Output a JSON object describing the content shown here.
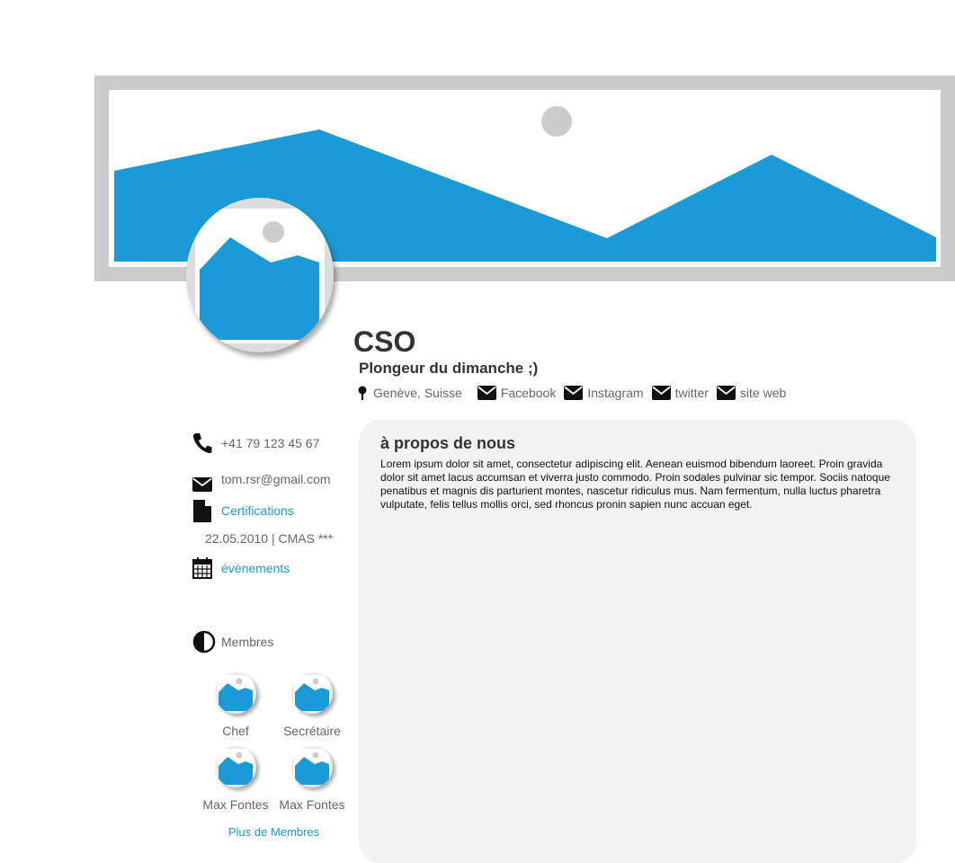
{
  "profile": {
    "name": "CSO",
    "tagline": "Plongeur du dimanche ;)"
  },
  "info_bar": {
    "location": "Genève, Suisse",
    "links": [
      "Facebook",
      "Instagram",
      "twitter",
      "site web"
    ]
  },
  "sidebar": {
    "phone": "+41 79 123 45 67",
    "email": "tom.rsr@gmail.com",
    "certifications_label": "Certifications",
    "certification_detail": "22.05.2010 | CMAS ***",
    "events_label": "évènements",
    "members_label": "Membres",
    "members": [
      {
        "name": "Chef"
      },
      {
        "name": "Secrétaire"
      },
      {
        "name": "Max Fontes"
      },
      {
        "name": "Max Fontes"
      }
    ],
    "more_members_label": "Plus de Membres"
  },
  "about": {
    "heading": "à propos de nous",
    "body": "Lorem ipsum dolor sit amet, consectetur adipiscing elit. Aenean euismod bibendum laoreet. Proin gravida dolor sit amet lacus accumsan et viverra justo commodo. Proin sodales pulvinar sic tempor. Sociis natoque penatibus et magnis dis parturient montes, nascetur ridiculus mus. Nam fermentum, nulla luctus pharetra vulputate, felis tellus mollis orci, sed rhoncus pronin sapien nunc accuan eget."
  },
  "colors": {
    "accent_blue": "#1a9bd7",
    "placeholder_gray": "#cccccc",
    "panel_bg": "#f2f2f2"
  },
  "icons": {
    "banner": "image-placeholder-icon",
    "location": "map-pin-icon",
    "social": "envelope-icon",
    "phone": "phone-icon",
    "email": "envelope-icon",
    "certifications": "document-icon",
    "events": "calendar-icon",
    "members": "half-circle-icon"
  }
}
